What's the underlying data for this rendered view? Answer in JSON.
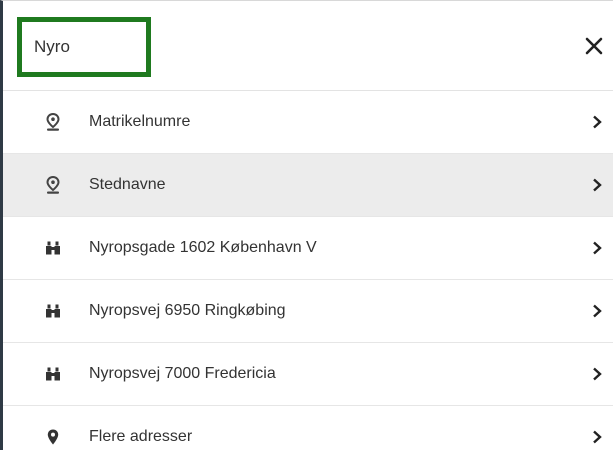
{
  "search": {
    "value": "Nyro",
    "placeholder": ""
  },
  "results": [
    {
      "label": "Matrikelnumre",
      "icon": "map-pin-outline-icon",
      "highlighted": false
    },
    {
      "label": "Stednavne",
      "icon": "map-pin-outline-icon",
      "highlighted": true
    },
    {
      "label": "Nyropsgade 1602 København V",
      "icon": "binoculars-icon",
      "highlighted": false
    },
    {
      "label": "Nyropsvej 6950 Ringkøbing",
      "icon": "binoculars-icon",
      "highlighted": false
    },
    {
      "label": "Nyropsvej 7000 Fredericia",
      "icon": "binoculars-icon",
      "highlighted": false
    },
    {
      "label": "Flere adresser",
      "icon": "map-marker-icon",
      "highlighted": false
    }
  ],
  "colors": {
    "focus_border": "#1f7a1f",
    "highlight_row": "#ececec",
    "left_border": "#2f3a45",
    "text": "#333333"
  }
}
